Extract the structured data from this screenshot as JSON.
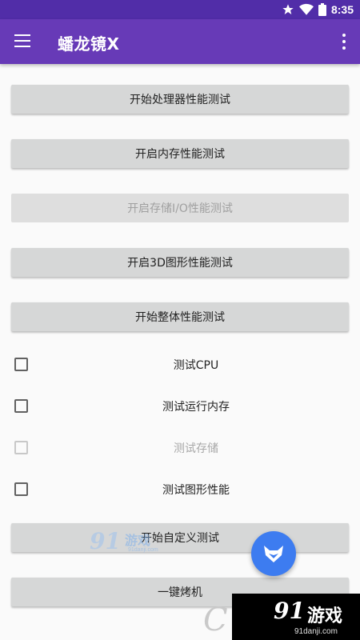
{
  "status_bar": {
    "time": "8:35",
    "icons": [
      "star-icon",
      "wifi-icon",
      "battery-icon"
    ]
  },
  "app_bar": {
    "title": "蟠龙镜X",
    "menu_icon": "hamburger-icon",
    "overflow_icon": "more-vert-icon"
  },
  "buttons": [
    {
      "label": "开始处理器性能测试",
      "enabled": true
    },
    {
      "label": "开启内存性能测试",
      "enabled": true
    },
    {
      "label": "开启存储I/O性能测试",
      "enabled": false
    },
    {
      "label": "开启3D图形性能测试",
      "enabled": true
    },
    {
      "label": "开始整体性能测试",
      "enabled": true
    }
  ],
  "checkboxes": [
    {
      "label": "测试CPU",
      "checked": false,
      "enabled": true
    },
    {
      "label": "测试运行内存",
      "checked": false,
      "enabled": true
    },
    {
      "label": "测试存储",
      "checked": false,
      "enabled": false
    },
    {
      "label": "测试图形性能",
      "checked": false,
      "enabled": true
    }
  ],
  "custom_test_button": {
    "label": "开始自定义测试"
  },
  "oneclick_button": {
    "label": "一键烤机"
  },
  "fab": {
    "icon": "fox-logo-icon"
  },
  "watermarks": {
    "left": {
      "brand": "91",
      "name": "游戏",
      "url": "91danji.com"
    },
    "corner": {
      "brand": "91",
      "name": "游戏",
      "url": "91danji.com"
    }
  },
  "colors": {
    "primary": "#673ab7",
    "primary_dark": "#512da8",
    "accent": "#3d7cf0",
    "button_bg": "#d6d7d7"
  }
}
